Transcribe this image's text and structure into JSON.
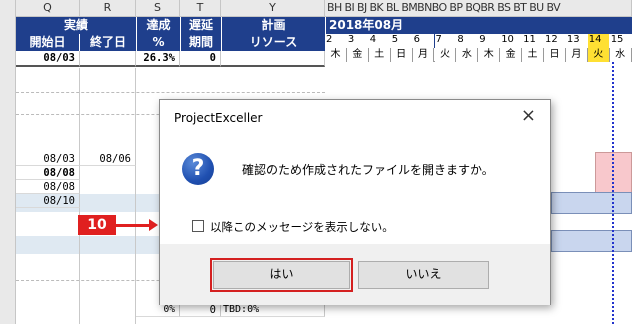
{
  "sheet": {
    "col_headers": [
      "Q",
      "R",
      "S",
      "T",
      "Y",
      "BH BI BJ BK BL BMBNBO BP BQBR BS BT BU BV"
    ],
    "header_actual_label": "実績",
    "header_start_label": "開始日",
    "header_end_label": "終了日",
    "header_progress_label": "達成",
    "header_progress_unit": "%",
    "header_delay_label": "遅延",
    "header_delay_sub": "期間",
    "header_plan_label": "計画",
    "header_resource_label": "リソース",
    "month_label": "2018年08月",
    "days": [
      "2",
      "3",
      "4",
      "5",
      "6",
      "7",
      "8",
      "9",
      "10",
      "11",
      "12",
      "13",
      "14",
      "15"
    ],
    "weekdays": [
      "木",
      "金",
      "土",
      "日",
      "月",
      "火",
      "水",
      "木",
      "金",
      "土",
      "日",
      "月",
      "火",
      "水"
    ],
    "summary_row": {
      "start": "08/03",
      "progress": "26.3%",
      "delay": "0"
    },
    "rows": [
      {
        "start": "08/03",
        "end": "08/06"
      },
      {
        "start": "08/08",
        "end": ""
      },
      {
        "start": "08/08",
        "end": ""
      },
      {
        "start": "08/10",
        "end": ""
      }
    ],
    "bottom_row": {
      "progress": "0%",
      "delay": "0",
      "resource": "TBD:0%"
    }
  },
  "dialog": {
    "title": "ProjectExceller",
    "close_glyph": "×",
    "message": "確認のため作成されたファイルを開きますか。",
    "checkbox_label": "以降このメッセージを表示しない。",
    "yes_label": "はい",
    "no_label": "いいえ",
    "icon": "question-icon"
  },
  "callout": {
    "step": "10",
    "color": "#e02020"
  },
  "colors": {
    "header_blue": "#1f3f8c",
    "today_highlight": "#ffe033",
    "bar_pink": "#f8c8cc",
    "bar_blue": "#c9d6ee"
  }
}
